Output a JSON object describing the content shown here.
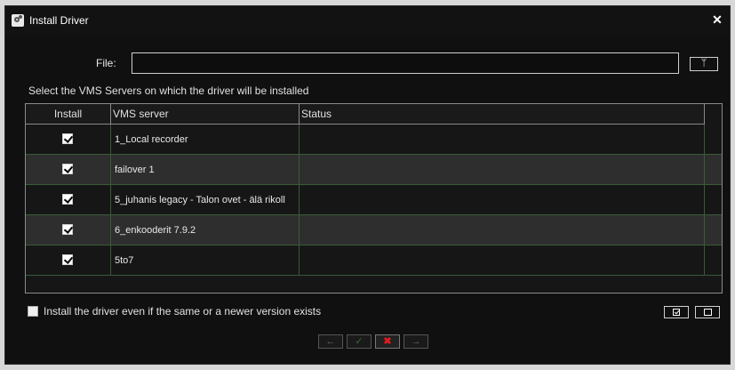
{
  "window": {
    "title": "Install Driver",
    "close_icon": "close-icon",
    "title_icon": "gears-icon"
  },
  "file": {
    "label": "File:",
    "value": "",
    "placeholder": "",
    "browse_icon": "browse-icon"
  },
  "instruction": "Select the VMS Servers on which the driver will be installed",
  "table": {
    "columns": [
      "Install",
      "VMS server",
      "Status"
    ],
    "rows": [
      {
        "install": true,
        "vms_server": "1_Local recorder",
        "status": ""
      },
      {
        "install": true,
        "vms_server": "failover 1",
        "status": ""
      },
      {
        "install": true,
        "vms_server": "5_juhanis legacy - Talon ovet - älä rikoll",
        "status": ""
      },
      {
        "install": true,
        "vms_server": "6_enkooderit 7.9.2",
        "status": ""
      },
      {
        "install": true,
        "vms_server": "5to7",
        "status": ""
      }
    ]
  },
  "force_install": {
    "label": "Install the driver even if the same or a newer version exists",
    "checked": false
  },
  "selection_buttons": {
    "select_all_icon": "select-all-icon",
    "select_none_icon": "select-none-icon"
  },
  "nav": {
    "prev": "←",
    "ok": "✓",
    "cancel": "✖",
    "next": "→"
  },
  "colors": {
    "background": "#101010",
    "row_alt": "#2e2e2e",
    "grid": "#3a5a3a",
    "cancel": "#e21c1c"
  }
}
